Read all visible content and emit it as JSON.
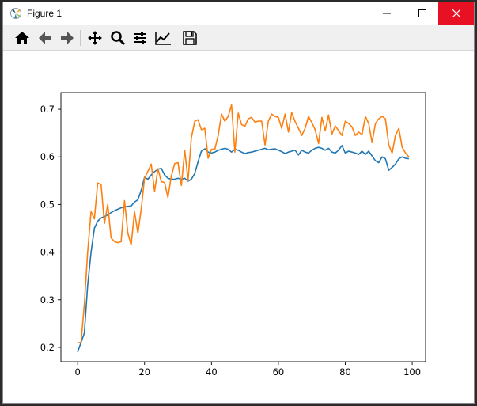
{
  "window": {
    "title": "Figure 1",
    "controls": [
      "minimize",
      "maximize",
      "close"
    ]
  },
  "toolbar": {
    "buttons": [
      {
        "name": "home",
        "icon": "home-icon"
      },
      {
        "name": "back",
        "icon": "arrow-left-icon"
      },
      {
        "name": "forward",
        "icon": "arrow-right-icon"
      },
      {
        "name": "pan",
        "icon": "move-icon"
      },
      {
        "name": "zoom",
        "icon": "magnifier-icon"
      },
      {
        "name": "subplots",
        "icon": "sliders-icon"
      },
      {
        "name": "edit-axis",
        "icon": "line-chart-icon"
      },
      {
        "name": "save",
        "icon": "floppy-disk-icon"
      }
    ]
  },
  "colors": {
    "series1": "#1f77b4",
    "series2": "#ff7f0e",
    "close_button": "#e81123"
  },
  "chart_data": {
    "type": "line",
    "xlim": [
      -5,
      104
    ],
    "ylim": [
      0.17,
      0.735
    ],
    "xticks": [
      0,
      20,
      40,
      60,
      80,
      100
    ],
    "yticks": [
      0.2,
      0.3,
      0.4,
      0.5,
      0.6,
      0.7
    ],
    "x": [
      0,
      1,
      2,
      3,
      4,
      5,
      6,
      7,
      8,
      9,
      10,
      11,
      12,
      13,
      14,
      15,
      16,
      17,
      18,
      19,
      20,
      21,
      22,
      23,
      24,
      25,
      26,
      27,
      28,
      29,
      30,
      31,
      32,
      33,
      34,
      35,
      36,
      37,
      38,
      39,
      40,
      41,
      42,
      43,
      44,
      45,
      46,
      47,
      48,
      49,
      50,
      51,
      52,
      53,
      54,
      55,
      56,
      57,
      58,
      59,
      60,
      61,
      62,
      63,
      64,
      65,
      66,
      67,
      68,
      69,
      70,
      71,
      72,
      73,
      74,
      75,
      76,
      77,
      78,
      79,
      80,
      81,
      82,
      83,
      84,
      85,
      86,
      87,
      88,
      89,
      90,
      91,
      92,
      93,
      94,
      95,
      96,
      97,
      98,
      99
    ],
    "series": [
      {
        "values": [
          0.19,
          0.21,
          0.23,
          0.33,
          0.4,
          0.45,
          0.465,
          0.472,
          0.475,
          0.478,
          0.483,
          0.487,
          0.49,
          0.493,
          0.495,
          0.496,
          0.497,
          0.505,
          0.51,
          0.53,
          0.557,
          0.553,
          0.562,
          0.569,
          0.574,
          0.576,
          0.562,
          0.555,
          0.553,
          0.553,
          0.555,
          0.553,
          0.555,
          0.549,
          0.553,
          0.565,
          0.59,
          0.612,
          0.617,
          0.61,
          0.608,
          0.61,
          0.614,
          0.616,
          0.618,
          0.616,
          0.61,
          0.616,
          0.614,
          0.61,
          0.607,
          0.609,
          0.61,
          0.612,
          0.614,
          0.616,
          0.618,
          0.615,
          0.616,
          0.617,
          0.614,
          0.611,
          0.607,
          0.61,
          0.612,
          0.614,
          0.604,
          0.614,
          0.61,
          0.608,
          0.614,
          0.618,
          0.62,
          0.618,
          0.614,
          0.618,
          0.61,
          0.608,
          0.614,
          0.624,
          0.608,
          0.612,
          0.61,
          0.608,
          0.605,
          0.612,
          0.605,
          0.612,
          0.602,
          0.592,
          0.588,
          0.6,
          0.596,
          0.572,
          0.578,
          0.585,
          0.596,
          0.6,
          0.597,
          0.596
        ]
      },
      {
        "values": [
          0.21,
          0.21,
          0.29,
          0.4,
          0.485,
          0.47,
          0.545,
          0.542,
          0.46,
          0.5,
          0.43,
          0.422,
          0.42,
          0.422,
          0.508,
          0.44,
          0.415,
          0.485,
          0.44,
          0.49,
          0.555,
          0.57,
          0.585,
          0.528,
          0.575,
          0.548,
          0.546,
          0.515,
          0.56,
          0.586,
          0.588,
          0.54,
          0.614,
          0.55,
          0.64,
          0.675,
          0.678,
          0.657,
          0.66,
          0.597,
          0.616,
          0.616,
          0.645,
          0.69,
          0.675,
          0.685,
          0.709,
          0.61,
          0.692,
          0.668,
          0.664,
          0.68,
          0.683,
          0.673,
          0.675,
          0.675,
          0.625,
          0.675,
          0.69,
          0.685,
          0.683,
          0.66,
          0.69,
          0.652,
          0.693,
          0.674,
          0.66,
          0.645,
          0.66,
          0.685,
          0.672,
          0.657,
          0.628,
          0.683,
          0.655,
          0.688,
          0.648,
          0.665,
          0.655,
          0.645,
          0.675,
          0.67,
          0.663,
          0.645,
          0.652,
          0.647,
          0.685,
          0.67,
          0.63,
          0.67,
          0.68,
          0.685,
          0.68,
          0.625,
          0.608,
          0.645,
          0.66,
          0.62,
          0.608,
          0.6
        ]
      }
    ]
  }
}
